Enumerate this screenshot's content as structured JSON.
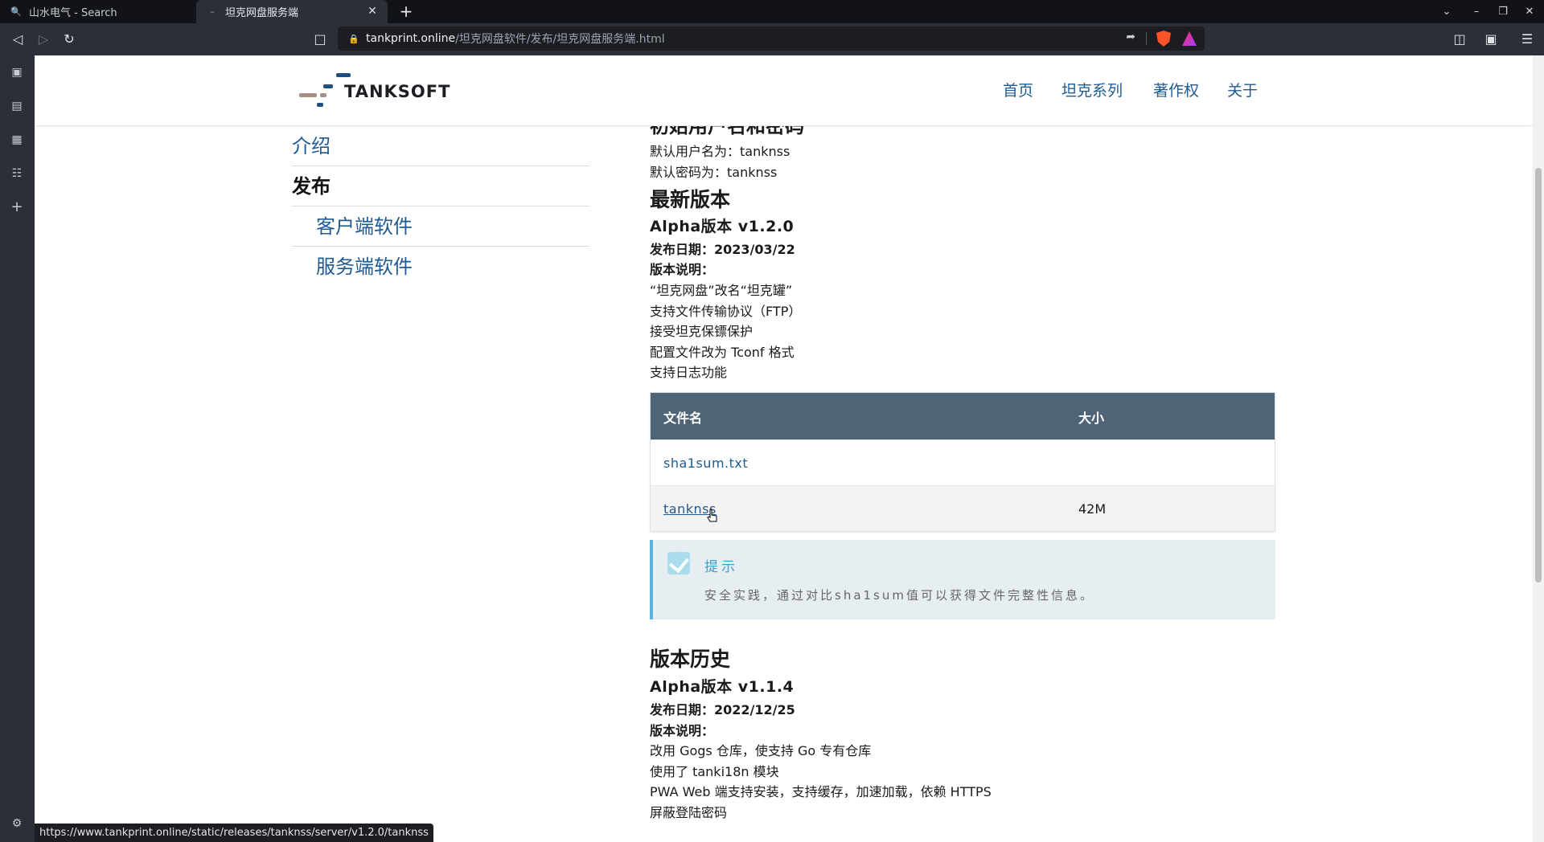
{
  "browser": {
    "tabs": [
      {
        "title": "山水电气 - Search",
        "favicon": "search-icon",
        "active": false
      },
      {
        "title": "坦克网盘服务端",
        "favicon": "page-icon",
        "active": true
      }
    ],
    "url": {
      "host": "tankprint.online",
      "path": "/坦克网盘软件/发布/坦克网盘服务端.html"
    },
    "status_url": "https://www.tankprint.online/static/releases/tanknss/server/v1.2.0/tanknss"
  },
  "site": {
    "logo_text": "TANKSOFT",
    "nav": [
      "首页",
      "坦克系列",
      "著作权",
      "关于"
    ]
  },
  "menu": {
    "intro": "介绍",
    "release": "发布",
    "client": "客户端软件",
    "server": "服务端软件"
  },
  "article": {
    "cut_heading": "初始用户名和密码",
    "default_user": "默认用户名为：tanknss",
    "default_pass": "默认密码为：tanknss",
    "latest_heading": "最新版本",
    "latest": {
      "version": "Alpha版本 v1.2.0",
      "date": "发布日期：2023/03/22",
      "notes_label": "版本说明：",
      "notes": [
        "“坦克网盘”改名“坦克罐”",
        "支持文件传输协议（FTP）",
        "接受坦克保镖保护",
        "配置文件改为 Tconf 格式",
        "支持日志功能"
      ]
    },
    "table": {
      "headers": [
        "文件名",
        "大小"
      ],
      "rows": [
        {
          "name": "sha1sum.txt",
          "size": ""
        },
        {
          "name": "tanknss",
          "size": "42M"
        }
      ]
    },
    "tip": {
      "title": "提示",
      "text": "安全实践，通过对比sha1sum值可以获得文件完整性信息。"
    },
    "history_heading": "版本历史",
    "history": {
      "version": "Alpha版本 v1.1.4",
      "date": "发布日期：2022/12/25",
      "notes_label": "版本说明：",
      "notes": [
        "改用 Gogs 仓库，使支持 Go 专有仓库",
        "使用了 tanki18n 模块",
        "PWA Web 端支持安装，支持缓存，加速加载，依赖 HTTPS",
        "屏蔽登陆密码"
      ]
    }
  },
  "colors": {
    "link": "#1f5a92",
    "table_header": "#4f6477",
    "tip_accent": "#5ab6d8"
  }
}
